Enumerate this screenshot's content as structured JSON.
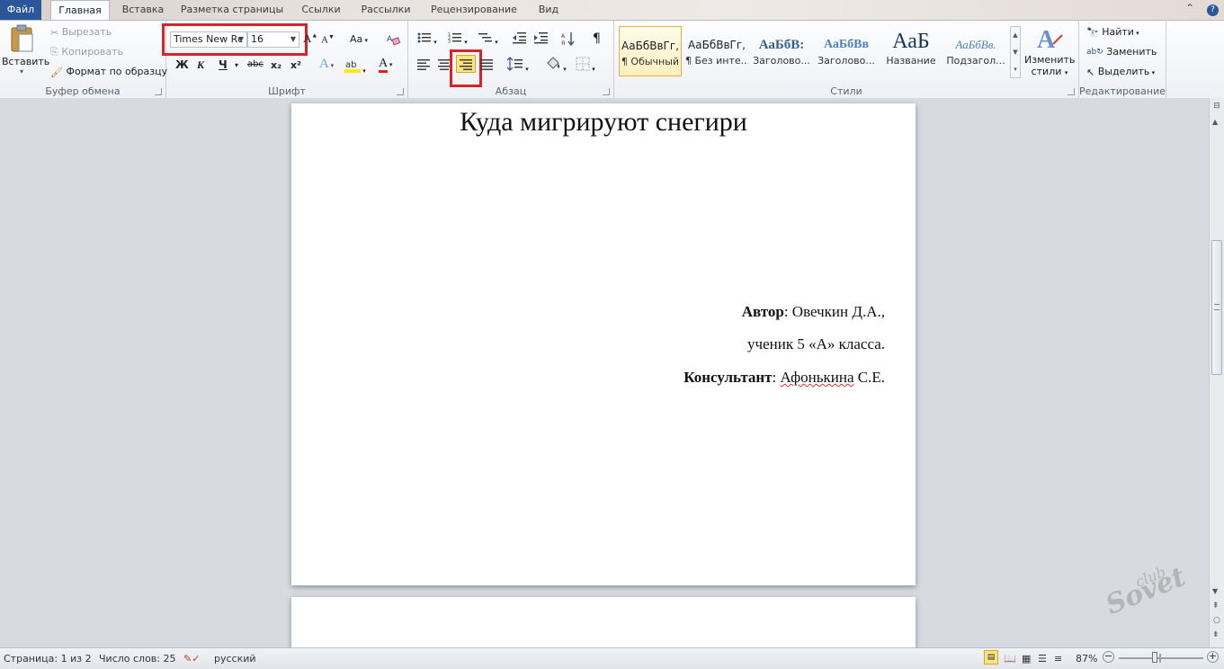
{
  "tabs": [
    "Файл",
    "Главная",
    "Вставка",
    "Разметка страницы",
    "Ссылки",
    "Рассылки",
    "Рецензирование",
    "Вид"
  ],
  "clipboard": {
    "paste_label": "Вставить",
    "cut_label": "Вырезать",
    "copy_label": "Копировать",
    "format_painter_label": "Формат по образцу",
    "group_label": "Буфер обмена"
  },
  "font": {
    "family_value": "Times New Rc",
    "size_value": "16",
    "bold": "Ж",
    "italic": "К",
    "underline": "Ч",
    "strike": "abc",
    "subscript": "x₂",
    "superscript": "x²",
    "grow": "A",
    "shrink": "A",
    "change_case": "Aa",
    "group_label": "Шрифт"
  },
  "paragraph": {
    "group_label": "Абзац",
    "pilcrow": "¶",
    "active_alignment": "align-right"
  },
  "styles": {
    "group_label": "Стили",
    "items": [
      {
        "sample": "АаБбВвГг,",
        "name": "¶ Обычный"
      },
      {
        "sample": "АаБбВвГг,",
        "name": "¶ Без инте..."
      },
      {
        "sample": "АаБбВ:",
        "name": "Заголово..."
      },
      {
        "sample": "АаБбВв",
        "name": "Заголово..."
      },
      {
        "sample": "АаБ",
        "name": "Название"
      },
      {
        "sample": "АаБбВв.",
        "name": "Подзагол..."
      }
    ],
    "change_styles_label1": "Изменить",
    "change_styles_label2": "стили"
  },
  "editing": {
    "find_label": "Найти",
    "replace_label": "Заменить",
    "select_label": "Выделить",
    "group_label": "Редактирование"
  },
  "document": {
    "title": "Куда мигрируют снегири",
    "author_label": "Автор",
    "author_value": ": Овечкин Д.А.,",
    "student_line": "ученик 5 «А» класса.",
    "consultant_label": "Консультант",
    "consultant_sep": ": ",
    "consultant_name": "Афонькина",
    "consultant_initials": " С.Е."
  },
  "status": {
    "page": "Страница: 1 из 2",
    "words": "Число слов: 25",
    "language": "русский",
    "zoom": "87%"
  },
  "watermark": {
    "small": "club",
    "large": "Sovet"
  },
  "colors": {
    "file_tab": "#2b579a",
    "highlight_box": "#d8232a",
    "active_button": "#fde47c"
  }
}
